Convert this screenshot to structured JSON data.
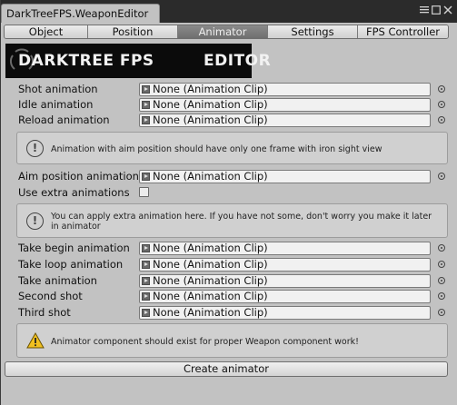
{
  "window": {
    "tab_title": "DarkTreeFPS.WeaponEditor",
    "controls": [
      "menu-icon",
      "maximize-icon",
      "close-icon"
    ]
  },
  "tabs": [
    {
      "label": "Object",
      "active": false
    },
    {
      "label": "Position",
      "active": false
    },
    {
      "label": "Animator",
      "active": true
    },
    {
      "label": "Settings",
      "active": false
    },
    {
      "label": "FPS Controller",
      "active": false
    }
  ],
  "banner": {
    "left_text": "DARKTREE FPS",
    "right_text": "EDITOR"
  },
  "fields_top": [
    {
      "label": "Shot animation",
      "value": "None (Animation Clip)"
    },
    {
      "label": "Idle animation",
      "value": "None (Animation Clip)"
    },
    {
      "label": "Reload animation",
      "value": "None (Animation Clip)"
    }
  ],
  "help1": "Animation with aim position should have only one frame with iron sight view",
  "aim_field": {
    "label": "Aim position animation",
    "value": "None (Animation Clip)"
  },
  "extra_toggle": {
    "label": "Use extra animations",
    "checked": false
  },
  "help2": {
    "line1": "You can apply extra animation here. If you have not some, don't worry you make it later",
    "line2": "in animator"
  },
  "fields_bottom": [
    {
      "label": "Take begin animation",
      "value": "None (Animation Clip)"
    },
    {
      "label": "Take loop animation",
      "value": "None (Animation Clip)"
    },
    {
      "label": "Take animation",
      "value": "None (Animation Clip)"
    },
    {
      "label": "Second shot",
      "value": "None (Animation Clip)"
    },
    {
      "label": "Third shot",
      "value": "None (Animation Clip)"
    }
  ],
  "warning": "Animator component should exist for proper Weapon component work!",
  "create_button": "Create animator",
  "colors": {
    "panel": "#c2c2c2",
    "titlebar": "#2b2b2b",
    "active_tab": "#7a7a7a",
    "warning": "#f0c020"
  }
}
